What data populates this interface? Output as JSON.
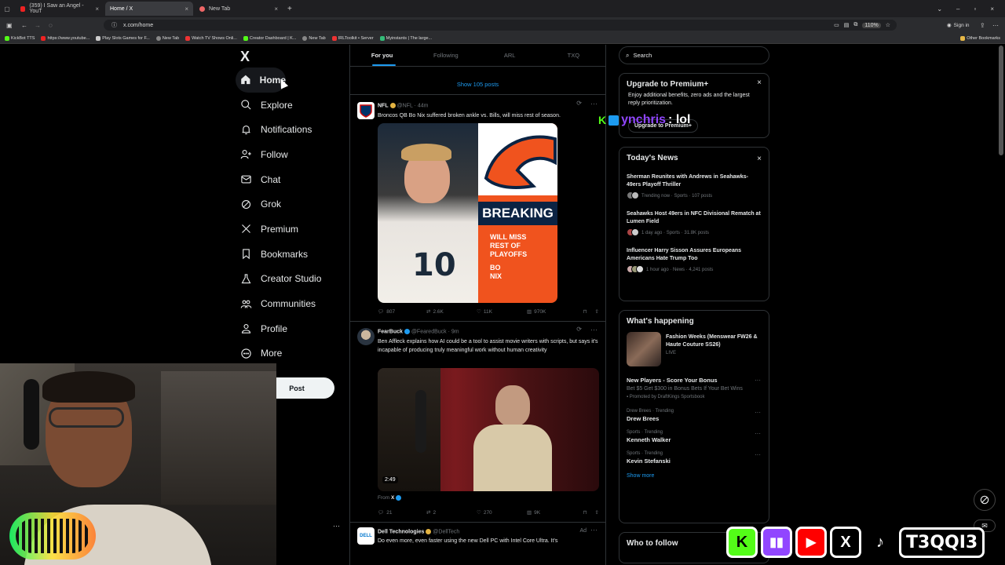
{
  "browser": {
    "tabs": [
      {
        "title": "(359) I Saw an Angel - YouT",
        "active": false
      },
      {
        "title": "Home / X",
        "active": true
      },
      {
        "title": "New Tab",
        "active": false
      }
    ],
    "url": "x.com/home",
    "zoom": "110%",
    "sign_in": "Sign in",
    "bookmarks": [
      "KickBot TTS",
      "https://www.youtube...",
      "Play Slots Games for F...",
      "New Tab",
      "Watch TV Shows Onli...",
      "Creator Dashboard | K...",
      "New Tab",
      "IRLToolkit • Server",
      "Myinstants | The large..."
    ],
    "other_bookmarks": "Other Bookmarks"
  },
  "nav": {
    "logo": "X",
    "items": [
      {
        "label": "Home",
        "icon": "home-icon"
      },
      {
        "label": "Explore",
        "icon": "search-icon"
      },
      {
        "label": "Notifications",
        "icon": "bell-icon"
      },
      {
        "label": "Follow",
        "icon": "follow-icon"
      },
      {
        "label": "Chat",
        "icon": "mail-icon"
      },
      {
        "label": "Grok",
        "icon": "grok-icon"
      },
      {
        "label": "Premium",
        "icon": "x-logo-icon"
      },
      {
        "label": "Bookmarks",
        "icon": "bookmark-icon"
      },
      {
        "label": "Creator Studio",
        "icon": "flask-icon"
      },
      {
        "label": "Communities",
        "icon": "people-icon"
      },
      {
        "label": "Profile",
        "icon": "person-icon"
      },
      {
        "label": "More",
        "icon": "more-circle-icon"
      }
    ],
    "post_button": "Post"
  },
  "feed": {
    "tabs": [
      "For you",
      "Following",
      "ARL",
      "TXQ"
    ],
    "show_posts": "Show 105 posts",
    "tweets": [
      {
        "name": "NFL",
        "handle": "@NFL",
        "time": "44m",
        "text": "Broncos QB Bo Nix suffered broken ankle vs. Bills, will miss rest of season.",
        "media_overlay": {
          "headline": "BREAKING",
          "line1": "WILL MISS",
          "line2": "REST OF PLAYOFFS",
          "line3": "BO",
          "line4": "NIX",
          "jersey": "10"
        },
        "replies": "807",
        "reposts": "2.6K",
        "likes": "11K",
        "views": "970K"
      },
      {
        "name": "FearBuck",
        "handle": "@FearedBuck",
        "time": "9m",
        "text": "Ben Affleck explains how AI could be a tool to assist movie writers with scripts, but says it's incapable of producing truly meaningful work without human creativity",
        "video_duration": "2:49",
        "from": "From",
        "from_handle": "X",
        "replies": "21",
        "reposts": "2",
        "likes": "270",
        "views": "9K"
      },
      {
        "name": "Dell Technologies",
        "handle": "@DellTech",
        "ad": "Ad",
        "text": "Do even more, even faster using the new Dell PC with Intel Core Ultra. It's"
      }
    ]
  },
  "right": {
    "search_placeholder": "Search",
    "premium": {
      "title": "Upgrade to Premium+",
      "body": "Enjoy additional benefits, zero ads and the largest reply prioritization.",
      "button": "Upgrade to Premium+"
    },
    "news": {
      "title": "Today's News",
      "items": [
        {
          "title": "Sherman Reunites with Andrews in Seahawks-49ers Playoff Thriller",
          "meta": "Trending now · Sports · 107 posts"
        },
        {
          "title": "Seahawks Host 49ers in NFC Divisional Rematch at Lumen Field",
          "meta": "1 day ago · Sports · 31.8K posts"
        },
        {
          "title": "Influencer Harry Sisson Assures Europeans Americans Hate Trump Too",
          "meta": "1 hour ago · News · 4,241 posts"
        }
      ]
    },
    "happening": {
      "title": "What's happening",
      "event": {
        "title": "Fashion Weeks (Menswear FW26 & Haute Couture SS26)",
        "status": "LIVE"
      },
      "promo": {
        "title": "New Players - Score Your Bonus",
        "body": "Bet $5 Get $300 in Bonus Bets If Your Bet Wins",
        "promoted": "Promoted by DraftKings Sportsbook"
      },
      "trends": [
        {
          "context": "Drew Brees · Trending",
          "name": "Drew Brees"
        },
        {
          "context": "Sports · Trending",
          "name": "Kenneth Walker"
        },
        {
          "context": "Sports · Trending",
          "name": "Kevin Stefanski"
        }
      ],
      "show_more": "Show more"
    },
    "who_to_follow": "Who to follow"
  },
  "overlay": {
    "chat_user": "ynchris",
    "chat_message": ": lol",
    "channel_name": "T3QQI3",
    "social_icons": [
      "kick-icon",
      "twitch-icon",
      "youtube-icon",
      "x-icon",
      "tiktok-icon"
    ]
  },
  "colors": {
    "accent": "#1d9bf0",
    "broncos_orange": "#f0531e",
    "gold_badge": "#e3b341",
    "kick_green": "#53fc18"
  }
}
